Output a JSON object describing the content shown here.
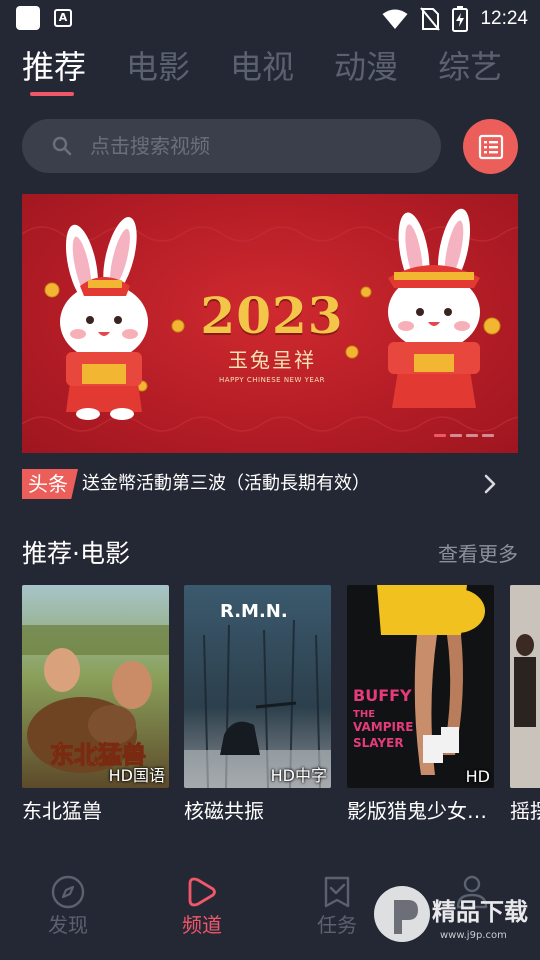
{
  "status_bar": {
    "time": "12:24",
    "icons": [
      "app-icon",
      "a-icon",
      "wifi-icon",
      "no-sim-icon",
      "battery-charging-icon"
    ]
  },
  "tabs": [
    {
      "label": "推荐",
      "active": true
    },
    {
      "label": "电影",
      "active": false
    },
    {
      "label": "电视",
      "active": false
    },
    {
      "label": "动漫",
      "active": false
    },
    {
      "label": "综艺",
      "active": false
    }
  ],
  "search": {
    "placeholder": "点击搜索视频",
    "icon": "search-icon",
    "history_icon": "list-icon"
  },
  "banner": {
    "year": "2023",
    "title_cn": "玉兔呈祥",
    "title_en": "HAPPY CHINESE NEW YEAR",
    "dots": 4,
    "active_dot": 0
  },
  "headline": {
    "badge": "头条",
    "text": "送金幣活動第三波（活動長期有效）"
  },
  "section": {
    "title": "推荐·电影",
    "more": "查看更多"
  },
  "movies": [
    {
      "title": "东北猛兽",
      "quality": "HD国语"
    },
    {
      "title": "核磁共振",
      "quality": "HD中字"
    },
    {
      "title": "影版猎鬼少女…",
      "quality": "HD"
    },
    {
      "title": "摇摆",
      "quality": ""
    }
  ],
  "posters": {
    "2": {
      "title_text": "BUFFY THE VAMPIRE SLAYER"
    },
    "1": {
      "title_text": "R.M.N."
    }
  },
  "bottom_nav": [
    {
      "label": "发现",
      "icon": "compass-icon",
      "active": false
    },
    {
      "label": "频道",
      "icon": "play-icon",
      "active": true
    },
    {
      "label": "任务",
      "icon": "task-icon",
      "active": false
    },
    {
      "label": "",
      "icon": "user-icon",
      "active": false
    }
  ],
  "watermark": {
    "text": "精品下载",
    "url": "www.j9p.com"
  },
  "colors": {
    "background": "#242834",
    "accent": "#f0586a",
    "inactive": "#5c6170"
  }
}
